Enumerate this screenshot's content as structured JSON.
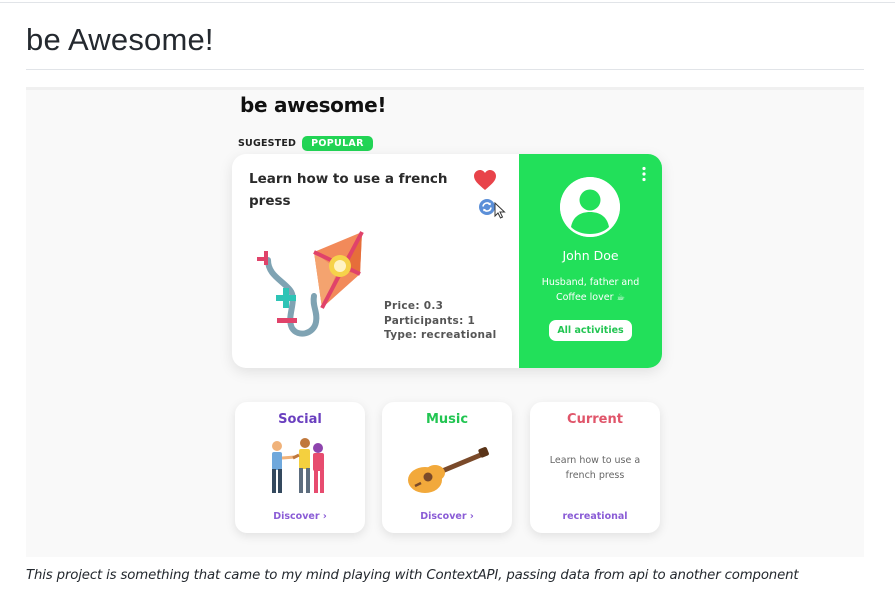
{
  "readme": {
    "title": "be Awesome!",
    "caption": "This project is something that came to my mind playing with ContextAPI, passing data from api to another component"
  },
  "app": {
    "title": "be awesome!",
    "tabs": {
      "suggested": "SUGESTED",
      "popular": "POPULAR"
    },
    "activity": {
      "title": "Learn how to use a french press",
      "price": "Price: 0.3",
      "participants": "Participants: 1",
      "type": "Type: recreational"
    },
    "profile": {
      "name": "John Doe",
      "bio_line1": "Husband, father and",
      "bio_line2": "Coffee lover ☕",
      "button": "All activities"
    },
    "cards": [
      {
        "title": "Social",
        "link": "Discover ›"
      },
      {
        "title": "Music",
        "link": "Discover ›"
      },
      {
        "title": "Current",
        "text": "Learn how to use a french press",
        "link": "recreational"
      }
    ]
  },
  "colors": {
    "green": "#22e05a",
    "popular": "#22d455",
    "social": "#6a3fbf",
    "music": "#22c552",
    "current": "#e0556a",
    "link": "#8a5cd6",
    "heart": "#e8434a"
  },
  "icons": [
    "heart-icon",
    "refresh-icon",
    "mouse-cursor-icon",
    "kite-illustration",
    "kebab-menu-icon",
    "user-avatar-icon",
    "people-illustration",
    "guitar-illustration"
  ]
}
